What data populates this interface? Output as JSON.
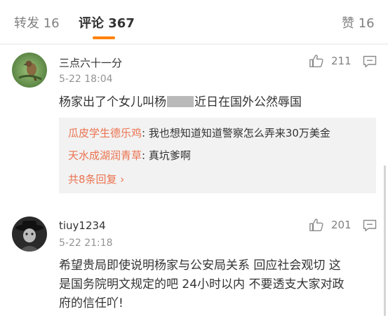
{
  "tabs": {
    "repost": "转发 16",
    "comments": "评论 367",
    "likes": "赞 16"
  },
  "comments": [
    {
      "username": "三点六十一分",
      "timestamp": "5-22 18:04",
      "like_count": "211",
      "text_before": "杨家出了个女儿叫杨",
      "text_after": "近日在国外公然辱国",
      "replies": [
        {
          "author": "瓜皮学生德乐鸡",
          "text": ": 我也想知道知道警察怎么弄来30万美金"
        },
        {
          "author": "天水成湖润青草",
          "text": ": 真坑爹啊"
        }
      ],
      "more_replies": "共8条回复 ›"
    },
    {
      "username": "tiuy1234",
      "timestamp": "5-22 21:18",
      "like_count": "201",
      "text_lines": [
        "希望贵局即使说明杨家与公安局关系 回应社会观切  这",
        "是国务院明文规定的吧 24小时以内 不要透支大家对政",
        "府的信任吖!"
      ]
    }
  ],
  "colors": {
    "accent": "#ff8200",
    "link": "#eb7350",
    "reply_bg": "#f2f2f2"
  },
  "icons": [
    "like-icon",
    "comment-more-icon"
  ]
}
